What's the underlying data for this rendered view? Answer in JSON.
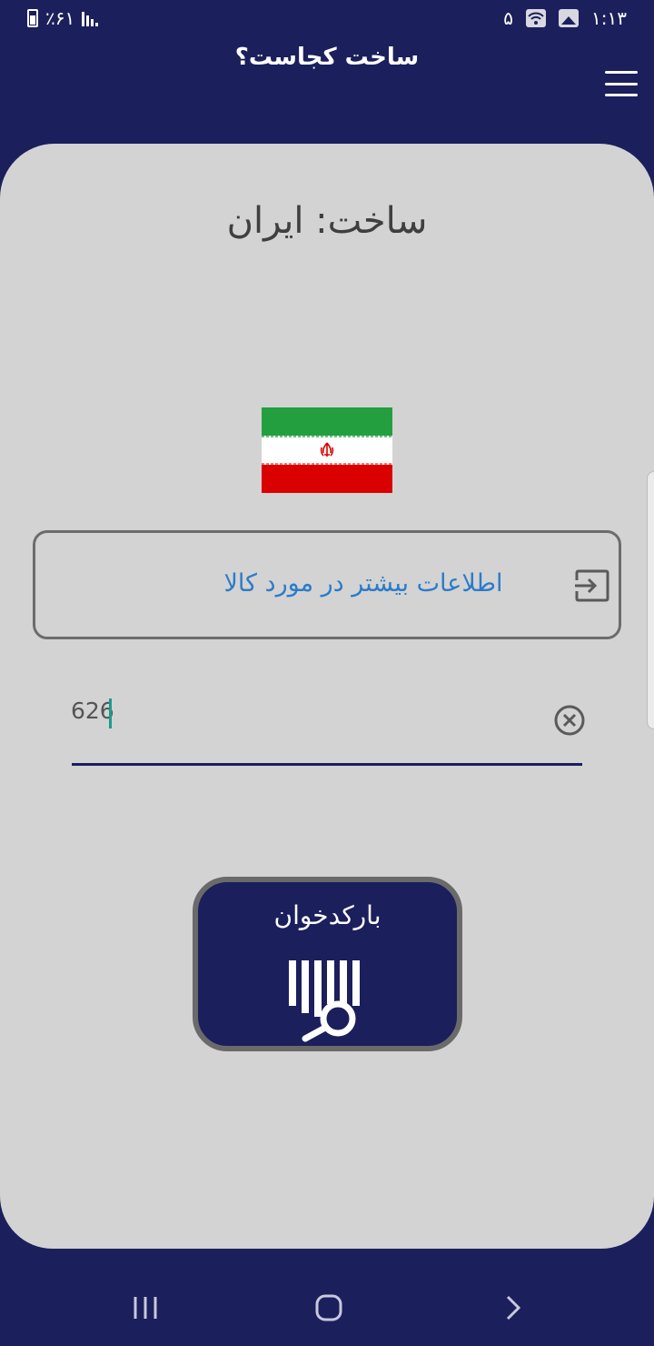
{
  "status_bar": {
    "time": "۱:۱۳",
    "notification_count": "۵",
    "battery": "٪۶۱",
    "icons": [
      "wifi-icon",
      "gallery-icon",
      "signal-icon",
      "battery-icon"
    ]
  },
  "app_bar": {
    "title": "ساخت کجاست؟",
    "menu_icon": "hamburger-menu-icon"
  },
  "result": {
    "made_in_text": "ساخت: ایران",
    "flag": "iran-flag",
    "flag_colors": [
      "#239f40",
      "#ffffff",
      "#da0000"
    ]
  },
  "info_button": {
    "label": "اطلاعات بیشتر در مورد کالا",
    "icon": "exit-to-app-icon"
  },
  "barcode_field": {
    "value": "626",
    "clear_icon": "clear-circle-icon"
  },
  "scan_button": {
    "label": "بارکدخوان",
    "icon": "barcode-search-icon"
  },
  "nav_bar": {
    "items": [
      "recents-icon",
      "home-icon",
      "back-icon"
    ]
  },
  "colors": {
    "primary": "#1b1f5c",
    "card": "#d3d3d3",
    "link": "#2b7bc9",
    "accent": "#1b9b8c"
  }
}
